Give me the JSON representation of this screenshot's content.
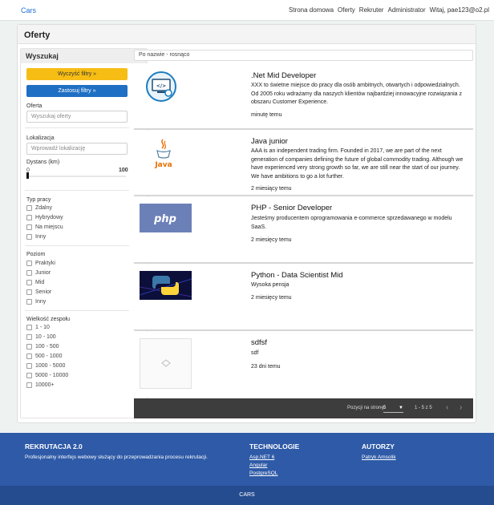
{
  "nav": {
    "brand": "Cars",
    "links": [
      "Strona domowa",
      "Oferty",
      "Rekruter",
      "Administrator",
      "Witaj, pae123@o2.pl"
    ]
  },
  "page": {
    "title": "Oferty"
  },
  "sidebar": {
    "title": "Wyszukaj",
    "clear_filters": "Wyczyść filtry »",
    "apply_filters": "Zastosuj filtry »",
    "offer_label": "Oferta",
    "offer_placeholder": "Wyszukaj oferty",
    "location_label": "Lokalizacja",
    "location_placeholder": "Wprowadź lokalizację",
    "distance_label": "Dystans (km)",
    "distance_min": "0",
    "distance_max": "100",
    "distance_value": 0,
    "work_type_label": "Typ pracy",
    "work_types": [
      "Zdalny",
      "Hybrydowy",
      "Na miejscu",
      "Inny"
    ],
    "level_label": "Poziom",
    "levels": [
      "Praktyki",
      "Junior",
      "Mid",
      "Senior",
      "Inny"
    ],
    "team_size_label": "Wielkość zespołu",
    "team_sizes": [
      "1 - 10",
      "10 - 100",
      "100 - 500",
      "500 - 1000",
      "1000 - 5000",
      "5000 - 10000",
      "10000+"
    ]
  },
  "sort": {
    "label": "Po nazwie - rosnąco"
  },
  "offers": [
    {
      "title": ".Net Mid Developer",
      "description": "XXX to świetne miejsce do pracy dla osób ambitnych, otwartych i odpowiedzialnych. Od 2005 roku wdrażamy dla naszych klientów najbardziej innowacyjne rozwiązania z obszaru Customer Experience.",
      "time": "minutę temu",
      "logo": "dotnet-logo"
    },
    {
      "title": "Java junior",
      "description": "AAA is an independent trading firm. Founded in 2017, we are part of the next generation of companies defining the future of global commodity trading. Although we have experienced very strong growth so far, we are still near the start of our journey. We have ambitions to go a lot further.",
      "time": "2 miesiący temu",
      "logo": "java-logo"
    },
    {
      "title": "PHP - Senior Developer",
      "description": "Jesteśmy producentem oprogramowania e-commerce sprzedawanego w modelu SaaS.",
      "time": "2 miesięcy temu",
      "logo": "php-logo"
    },
    {
      "title": "Python - Data Scientist Mid",
      "description": "Wysoka pensja",
      "time": "2 miesięcy temu",
      "logo": "python-logo"
    },
    {
      "title": "sdfsf",
      "description": "sdf",
      "time": "23 dni temu",
      "logo": "placeholder-logo"
    }
  ],
  "pagination": {
    "per_page_label": "Pozycji na stronę:",
    "per_page_value": "5",
    "range": "1 - 5 z 5",
    "prev": "‹",
    "next": "›"
  },
  "footer": {
    "col1_title": "REKRUTACJA 2.0",
    "col1_text": "Profesjonalny interfejs webowy służący do przeprowadzania procesu rekrutacji.",
    "col2_title": "TECHNOLOGIE",
    "col2_links": [
      "Asp.NET 6",
      "Angular",
      "PostgreSQL"
    ],
    "col3_title": "AUTORZY",
    "col3_links": [
      "Patryk Amsolik"
    ],
    "bottom": "CARS"
  },
  "colors": {
    "brand": "#1a6fd0",
    "yellow_button": "#f6bd14",
    "blue_button": "#1f6fc4",
    "footer": "#2e5aa7",
    "footer_bottom": "#254c8f",
    "pager": "#3d3d3d"
  }
}
